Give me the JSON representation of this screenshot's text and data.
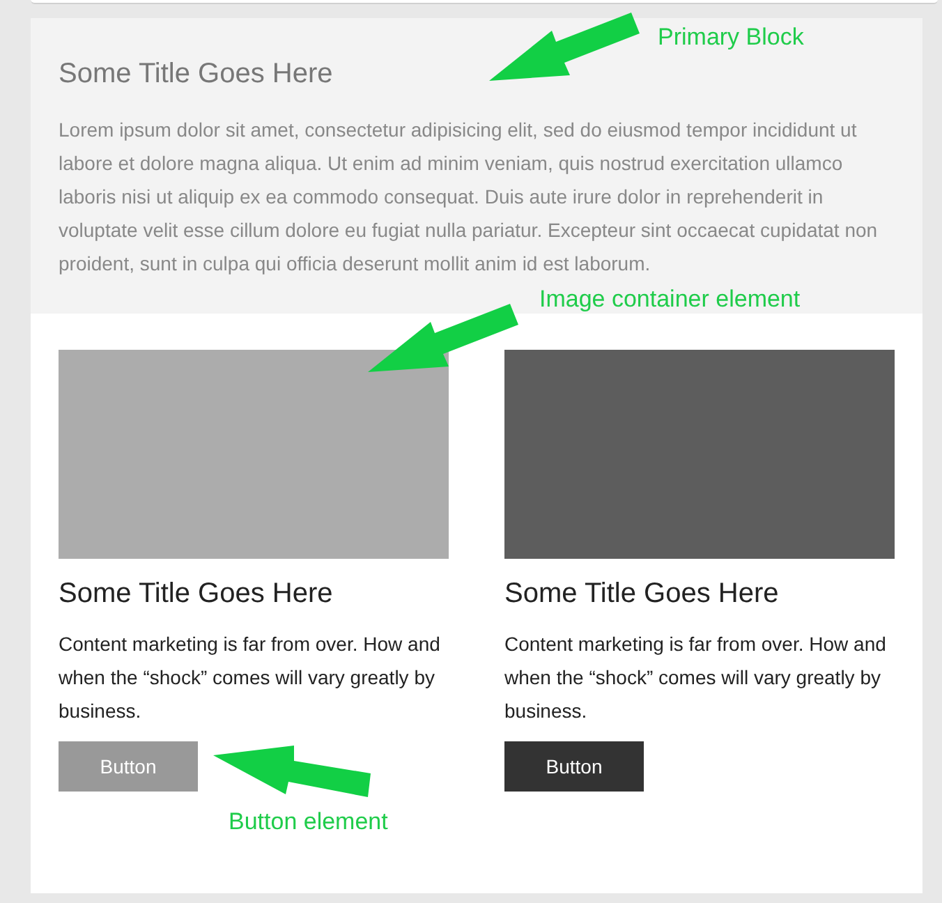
{
  "primary_block": {
    "title": "Some Title Goes Here",
    "text": "Lorem ipsum dolor sit amet, consectetur adipisicing elit, sed do eiusmod tempor incididunt ut labore et dolore magna aliqua. Ut enim ad minim veniam, quis nostrud exercitation ullamco laboris nisi ut aliquip ex ea commodo consequat. Duis aute irure dolor in reprehenderit in voluptate velit esse cillum dolore eu fugiat nulla pariatur. Excepteur sint occaecat cupidatat non proident, sunt in culpa qui officia deserunt mollit anim id est laborum."
  },
  "cards": [
    {
      "kind": "light",
      "title": "Some Title Goes Here",
      "text": "Content marketing is far from over. How and when the “shock” comes will vary greatly by business.",
      "button": "Button"
    },
    {
      "kind": "dark",
      "title": "Some Title Goes Here",
      "text": "Content marketing is far from over. How and when the “shock” comes will vary greatly by business.",
      "button": "Button"
    }
  ],
  "annotations": [
    {
      "label": "Primary Block"
    },
    {
      "label": "Image container element"
    },
    {
      "label": "Button element"
    }
  ]
}
